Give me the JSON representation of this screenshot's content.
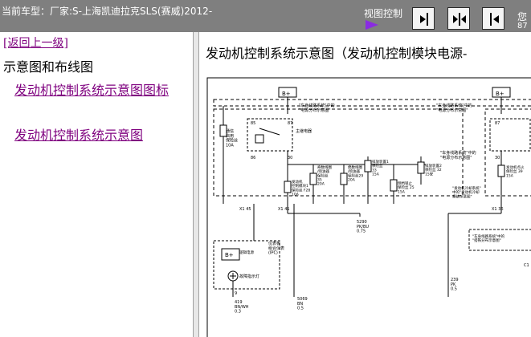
{
  "header": {
    "vehicle_title": "当前车型：厂家:S-上海凯迪拉克SLS(赛威)2012-",
    "view_control_label": "视图控制",
    "right_glyph": "您",
    "right_number": "87",
    "buttons": [
      {
        "icon": "expand-right-icon",
        "action": "show-right"
      },
      {
        "icon": "split-view-icon",
        "action": "split"
      },
      {
        "icon": "expand-left-icon",
        "action": "show-left"
      }
    ]
  },
  "colors": {
    "toolbar_bg": "#7f7f7f",
    "link_visited": "#7f007f",
    "arrow": "#8a2be2"
  },
  "sidebar": {
    "back_link": "[返回上一级]",
    "section_title": "示意图和布线图",
    "links": [
      "发动机控制系统示意图图标",
      "发动机控制系统示意图"
    ]
  },
  "main": {
    "title": "发动机控制系统示意图（发动机控制模块电源-",
    "diagram_labels": {
      "bplus_left": "B+",
      "bplus_right": "B+",
      "bplus_ipc": "B+",
      "fuse_comm": "通信\n启用\n保险丝\n10A",
      "relay_main": "主继电器",
      "ref_power_1": "\"车身线路系统\"中的\n\"电源分布示意图\"",
      "ref_power_2": "\"车身线路系统\"中的\n\"电源分布示意图\"",
      "ref_power_3": "\"车身线路系统\"中的\n\"电源分布示意图\"",
      "ref_ground": "\"车身线路系统\"中的\n\"搭铁分布示意图\"",
      "fuse_ecm": "发动机\n控制模块1\n保险丝 F28\n10A",
      "fuse_odd": "奇数线圈\n/喷油器\n保险丝\n35\n20A",
      "fuse_even": "偶数线圈\n/喷油器\n保险丝29\n20A",
      "fuse_emission1": "排放装置1\n保险丝\n33\n15A",
      "fuse_trans": "倒档锁止\n保险丝 25\n15A",
      "fuse_emission2": "排放装置2\n保险丝 32\n15安",
      "fuse_ign": "发动机点火\n保险丝 39\n15A",
      "cooling_ref": "\"发动机冷却系统\"\n中的\"发动机冷却\n系统示意图\"",
      "ipc": "仪表板\n组合仪表\n(IPC)",
      "ipc_power": "逻辑电源",
      "mil": "故障指示灯",
      "pins": [
        "85",
        "87",
        "86",
        "30",
        "30",
        "87",
        "85",
        "X1 45",
        "X1 41",
        "X1 36",
        "9",
        "C1"
      ],
      "wires": [
        {
          "id": "5290",
          "color": "PK/BU",
          "gauge": "0.75"
        },
        {
          "id": "419",
          "color": "BN/WH",
          "gauge": "0.3"
        },
        {
          "id": "5069",
          "color": "BN",
          "gauge": "0.5"
        },
        {
          "id": "239",
          "color": "PK",
          "gauge": "0.5"
        }
      ]
    }
  }
}
